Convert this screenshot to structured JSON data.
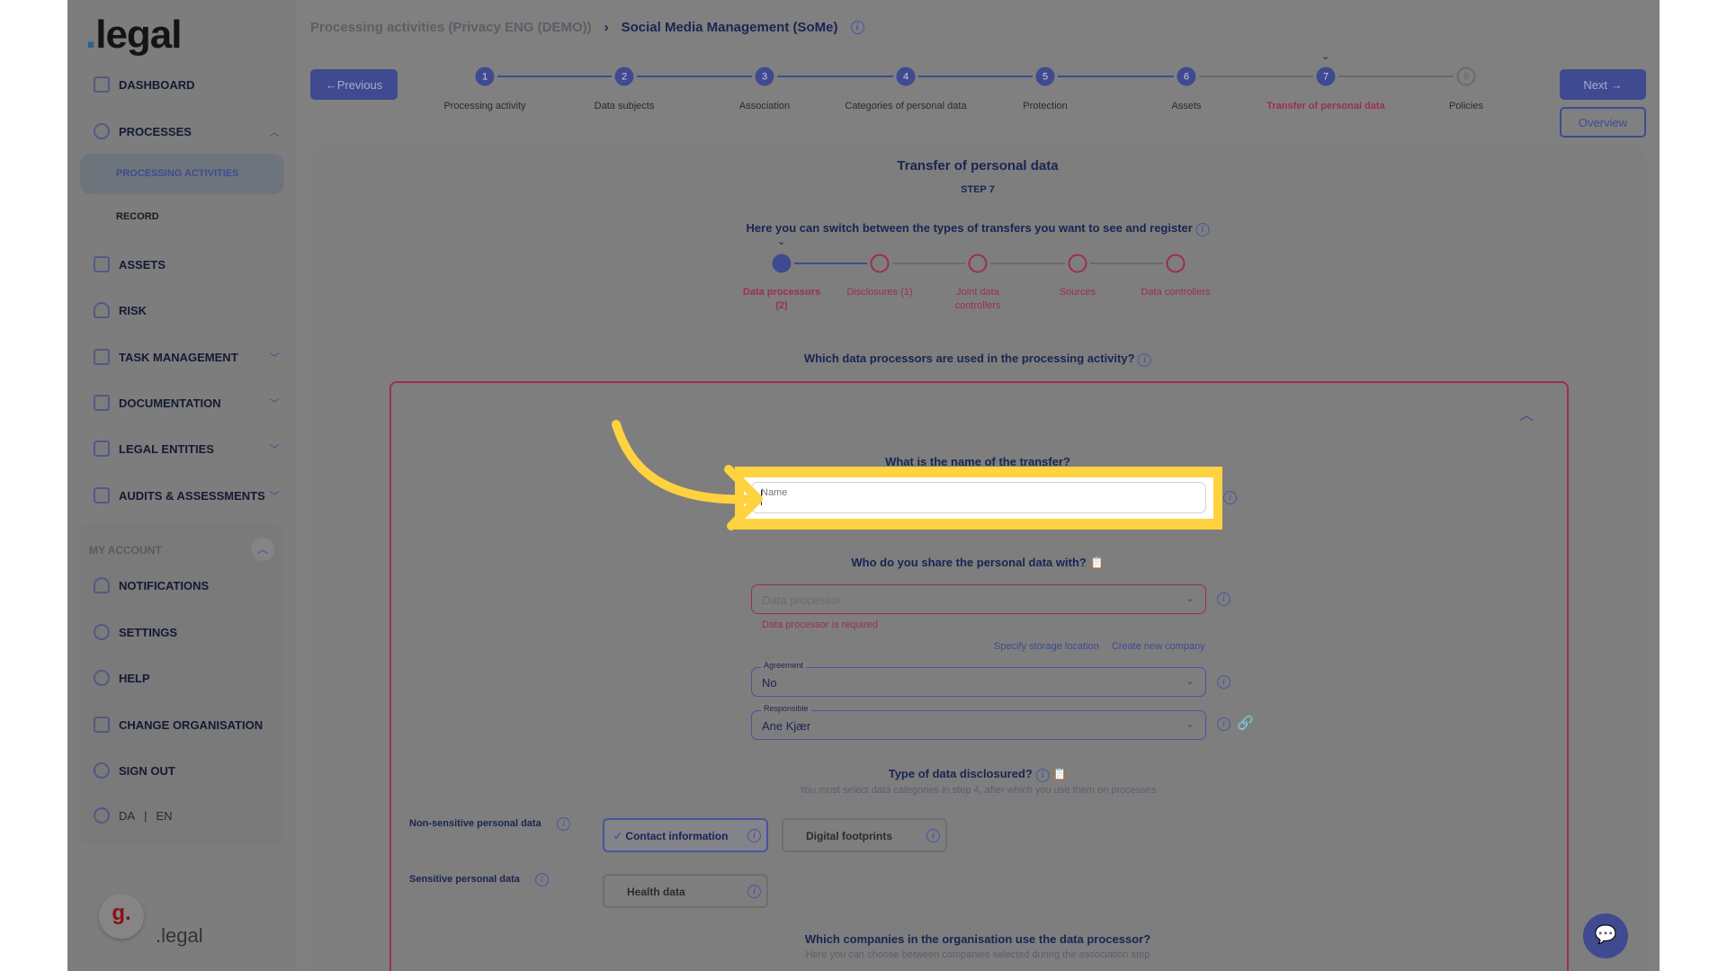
{
  "brand": {
    "logo": ".legal",
    "footer_logo": ".legal",
    "footer_badge": "g."
  },
  "sidebar": {
    "items": [
      {
        "label": "DASHBOARD",
        "icon": "grid-icon"
      },
      {
        "label": "PROCESSES",
        "icon": "processes-icon"
      },
      {
        "label": "PROCESSING ACTIVITIES"
      },
      {
        "label": "RECORD"
      },
      {
        "label": "ASSETS",
        "icon": "assets-icon"
      },
      {
        "label": "RISK",
        "icon": "gauge-icon"
      },
      {
        "label": "TASK MANAGEMENT",
        "icon": "tasks-icon"
      },
      {
        "label": "DOCUMENTATION",
        "icon": "document-icon"
      },
      {
        "label": "LEGAL ENTITIES",
        "icon": "building-icon"
      },
      {
        "label": "AUDITS & ASSESSMENTS",
        "icon": "audit-icon"
      }
    ],
    "account": {
      "label": "MY ACCOUNT",
      "items": [
        {
          "label": "NOTIFICATIONS",
          "icon": "bell-icon"
        },
        {
          "label": "SETTINGS",
          "icon": "gear-icon"
        },
        {
          "label": "HELP",
          "icon": "help-icon"
        },
        {
          "label": "CHANGE ORGANISATION",
          "icon": "switch-icon"
        },
        {
          "label": "SIGN OUT",
          "icon": "sign-out-icon"
        }
      ]
    },
    "lang": {
      "da": "DA",
      "sep": "|",
      "en": "EN"
    }
  },
  "breadcrumb": {
    "parent": "Processing activities (Privacy ENG (DEMO))",
    "current": "Social Media Management (SoMe)"
  },
  "nav": {
    "previous": "Previous",
    "next": "Next",
    "overview": "Overview"
  },
  "steps": [
    {
      "n": "1",
      "label": "Processing activity",
      "done": true
    },
    {
      "n": "2",
      "label": "Data subjects",
      "done": true
    },
    {
      "n": "3",
      "label": "Association",
      "done": true
    },
    {
      "n": "4",
      "label": "Categories of personal data",
      "done": true
    },
    {
      "n": "5",
      "label": "Protection",
      "done": true
    },
    {
      "n": "6",
      "label": "Assets",
      "done": true
    },
    {
      "n": "7",
      "label": "Transfer of personal data",
      "current": true
    },
    {
      "n": "8",
      "label": "Policies",
      "done": false
    }
  ],
  "card": {
    "title": "Transfer of personal data",
    "step": "STEP 7",
    "switch_text": "Here you can switch between the types of transfers you want to see and register",
    "transfer_types": [
      "Data processors (2)",
      "Disclosures (1)",
      "Joint data controllers",
      "Sources",
      "Data controllers"
    ],
    "question": "Which data processors are used in the processing activity?"
  },
  "form": {
    "name_q": "What is the name of the transfer?",
    "name_placeholder": "Name",
    "name_value": "",
    "share_q": "Who do you share the personal data with?",
    "processor_placeholder": "Data processor",
    "processor_error": "Data processor is required",
    "link_storage": "Specify storage location",
    "link_company": "Create new company",
    "agreement_label": "Agreement",
    "agreement_value": "No",
    "responsible_label": "Responsible",
    "responsible_value": "Ane Kjær",
    "type_q": "Type of data disclosured?",
    "type_sub": "You must select data categories in step 4, after which you use them on processes",
    "nonsensitive_label": "Non-sensitive personal data",
    "nonsensitive": [
      {
        "label": "Contact information",
        "selected": true
      },
      {
        "label": "Digital footprints",
        "selected": false
      }
    ],
    "sensitive_label": "Sensitive personal data",
    "sensitive": [
      {
        "label": "Health data",
        "selected": false
      }
    ],
    "companies_q": "Which companies in the organisation use the data processor?",
    "companies_sub": "Here you can choose between companies selected during the association step"
  },
  "colors": {
    "highlight": "#ffd23f",
    "accent": "#404a91",
    "error": "#9c2f4c",
    "overlay": "#808080"
  }
}
